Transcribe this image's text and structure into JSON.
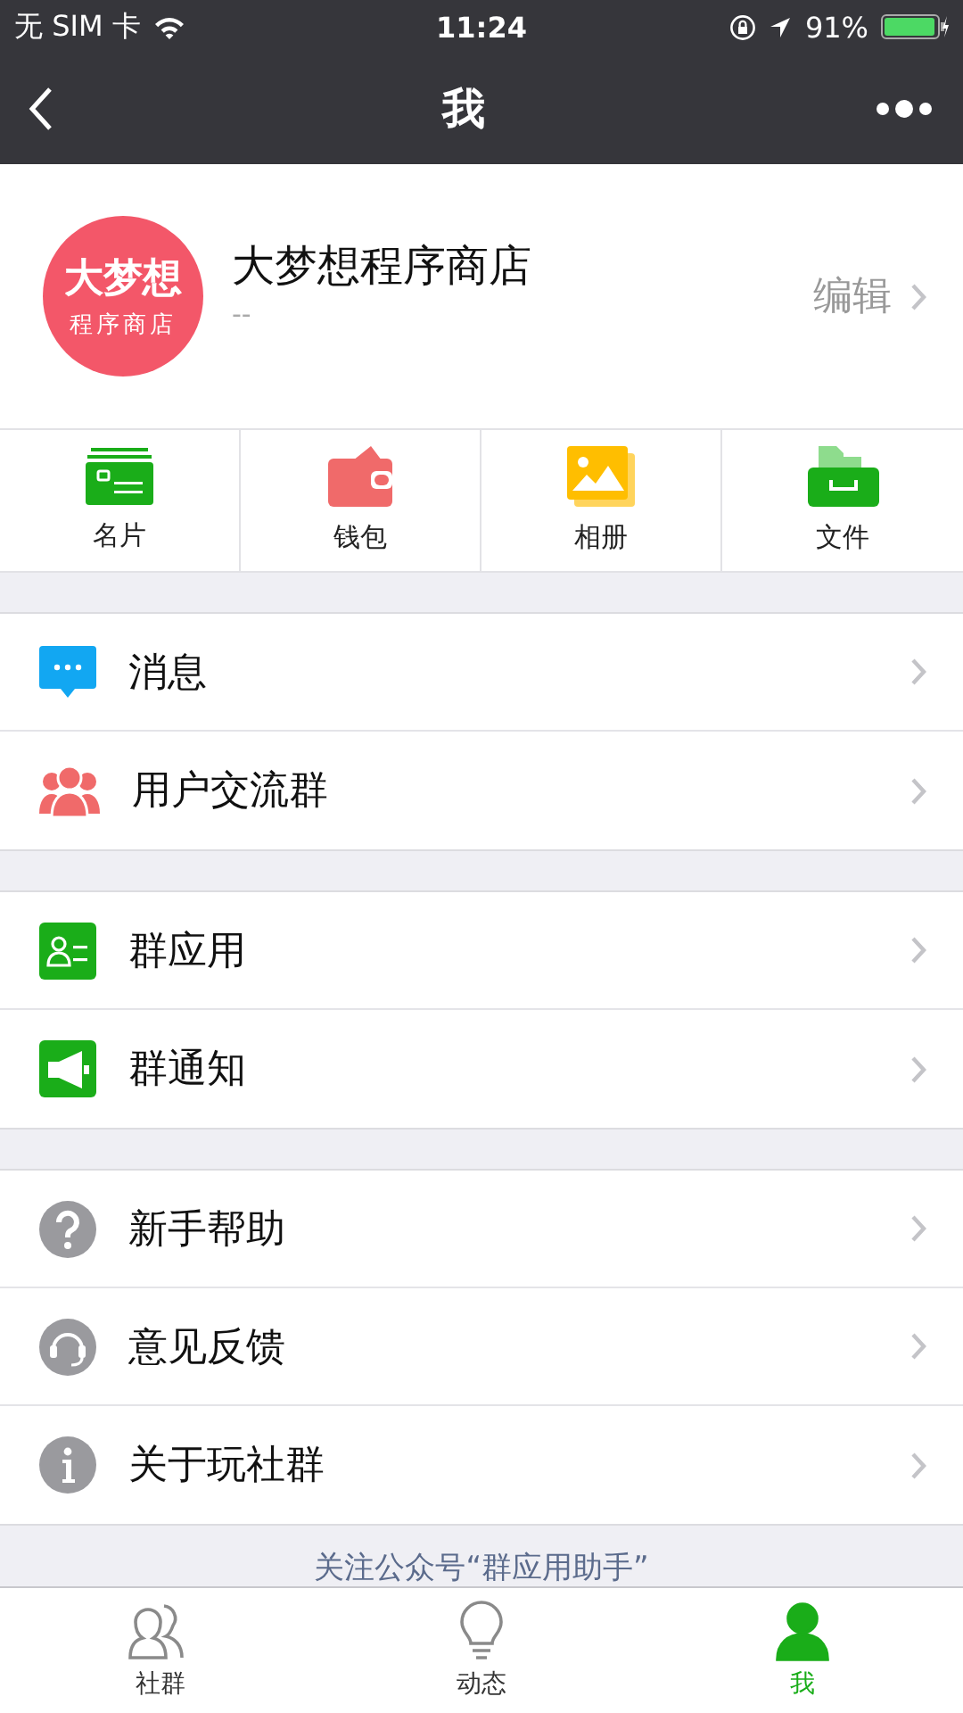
{
  "status_bar": {
    "carrier": "无 SIM 卡",
    "time": "11:24",
    "battery": "91%"
  },
  "nav_bar": {
    "title": "我"
  },
  "profile": {
    "name": "大梦想程序商店",
    "subtitle": "--",
    "avatar_line_1": "大梦想",
    "avatar_line_2": "程序商店",
    "edit": "编辑"
  },
  "shortcuts": [
    {
      "label": "名片"
    },
    {
      "label": "钱包"
    },
    {
      "label": "相册"
    },
    {
      "label": "文件"
    }
  ],
  "sections": [
    {
      "items": [
        {
          "label": "消息"
        },
        {
          "label": "用户交流群"
        }
      ]
    },
    {
      "items": [
        {
          "label": "群应用"
        },
        {
          "label": "群通知"
        }
      ]
    },
    {
      "items": [
        {
          "label": "新手帮助"
        },
        {
          "label": "意见反馈"
        },
        {
          "label": "关于玩社群"
        }
      ]
    }
  ],
  "footer_note": "关注公众号“群应用助手”",
  "tab_bar": [
    {
      "label": "社群",
      "selected": false
    },
    {
      "label": "动态",
      "selected": false
    },
    {
      "label": "我",
      "selected": true
    }
  ]
}
